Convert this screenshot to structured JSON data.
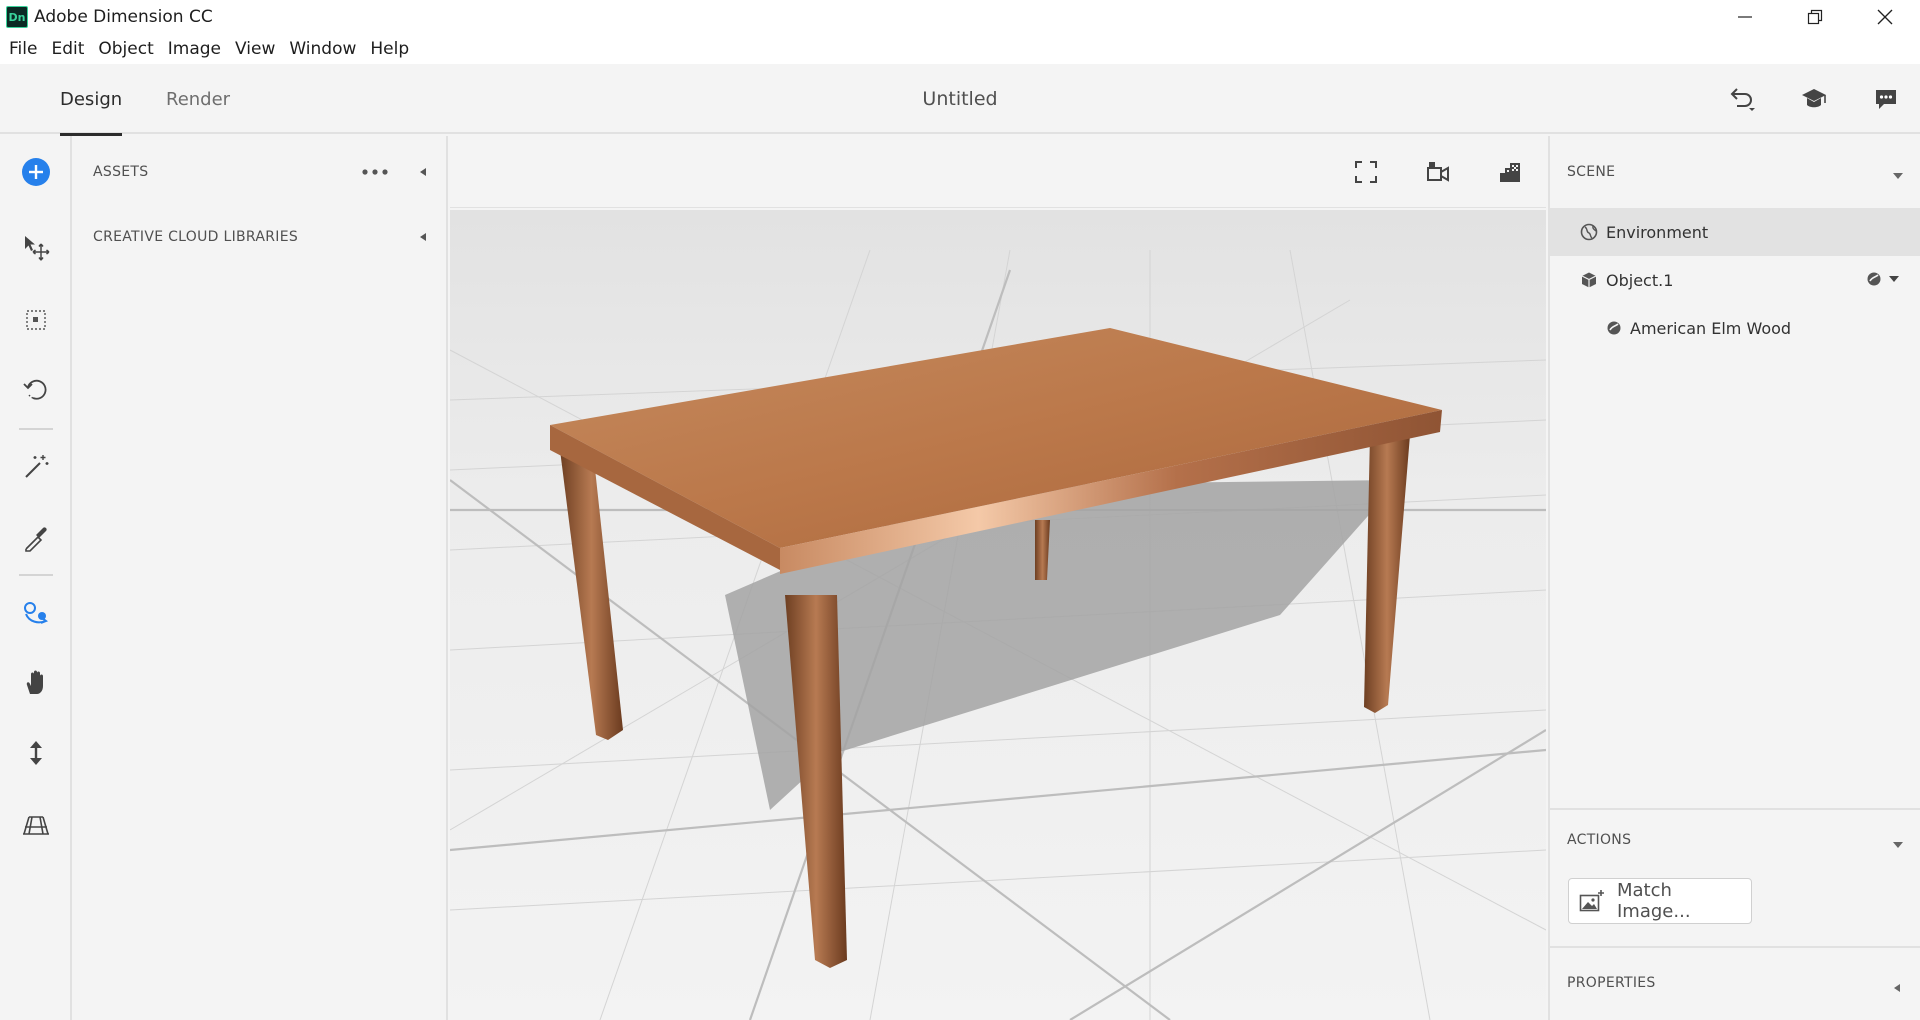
{
  "app": {
    "title": "Adobe Dimension CC",
    "icon_label": "Dn"
  },
  "menu": [
    "File",
    "Edit",
    "Object",
    "Image",
    "View",
    "Window",
    "Help"
  ],
  "header": {
    "tabs": [
      {
        "label": "Design",
        "active": true
      },
      {
        "label": "Render",
        "active": false
      }
    ],
    "doc_title": "Untitled",
    "icons": [
      "undo-icon",
      "learn-icon",
      "feedback-icon"
    ]
  },
  "tools": [
    "add-icon",
    "select-move-icon",
    "marquee-icon",
    "orbit-icon",
    "magic-wand-icon",
    "eyedropper-icon",
    "pan-camera-icon",
    "hand-icon",
    "dolly-icon",
    "horizon-icon"
  ],
  "assets": {
    "title": "ASSETS",
    "section": "CREATIVE CLOUD LIBRARIES"
  },
  "viewport_icons": [
    "fit-screen-icon",
    "camera-bookmark-icon",
    "render-preview-icon"
  ],
  "scene": {
    "title": "SCENE",
    "items": [
      {
        "label": "Environment",
        "icon": "globe-icon",
        "selected": true
      },
      {
        "label": "Object.1",
        "icon": "cube-icon",
        "selected": false
      },
      {
        "label": "American Elm Wood",
        "icon": "material-icon",
        "selected": false
      }
    ]
  },
  "actions": {
    "title": "ACTIONS",
    "match_image": "Match Image..."
  },
  "properties": {
    "title": "PROPERTIES"
  },
  "colors": {
    "accent": "#2680eb",
    "wood": "#b97348",
    "panel": "#f4f4f4"
  }
}
